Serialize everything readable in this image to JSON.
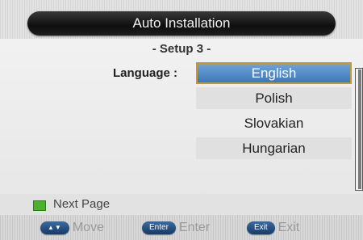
{
  "header": {
    "title": "Auto Installation",
    "subtitle": "- Setup 3 -"
  },
  "setup": {
    "language_label": "Language :",
    "options": [
      "English",
      "Polish",
      "Slovakian",
      "Hungarian"
    ],
    "selected": "English"
  },
  "footer": {
    "next_page": "Next Page",
    "hints": [
      {
        "key": "▲▼",
        "label": "Move"
      },
      {
        "key": "Enter",
        "label": "Enter"
      },
      {
        "key": "Exit",
        "label": "Exit"
      }
    ]
  },
  "colors": {
    "selected_fill": "#4f8cc9",
    "selected_border": "#c49a2c",
    "green_key": "#4cb031",
    "key_blue": "#1f4a80"
  }
}
